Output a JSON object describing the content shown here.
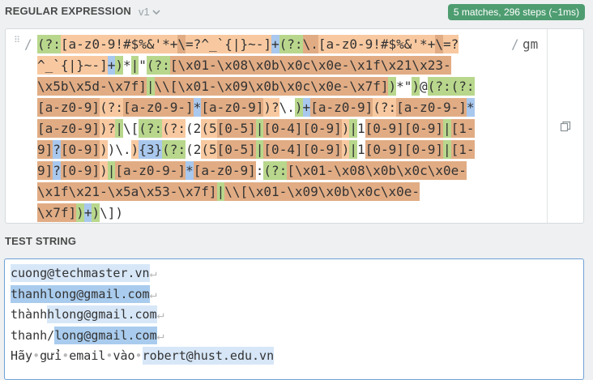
{
  "regex_section": {
    "title": "REGULAR EXPRESSION",
    "version": "v1",
    "match_info": "5 matches, 296 steps (~1ms)",
    "delimiter_open": "/",
    "delimiter_close": "/",
    "flags": "gm"
  },
  "regex_lines": [
    [
      [
        "(?:",
        "g"
      ],
      [
        "[a-z0-9!#$%&'*+",
        "o"
      ],
      [
        "\\",
        "d"
      ],
      [
        "=?^_`{|}~-]",
        "o"
      ],
      [
        "+",
        "b"
      ],
      [
        "(?:",
        "g"
      ],
      [
        "\\.",
        "d"
      ],
      [
        "[a-z0-9!#$%&'*+",
        "o"
      ],
      [
        "\\",
        "d"
      ],
      [
        "=?",
        "o"
      ]
    ],
    [
      [
        "^_`{|}~-]",
        "o"
      ],
      [
        "+",
        "b"
      ],
      [
        ")",
        "g"
      ],
      [
        "*",
        "n"
      ],
      [
        "|",
        "g"
      ],
      [
        "\"",
        "n"
      ],
      [
        "(?:",
        "g"
      ],
      [
        "[\\x01-\\x08\\x0b\\x0c\\x0e-\\x1f\\x21\\x23-",
        "d"
      ]
    ],
    [
      [
        "\\x5b\\x5d-\\x7f]",
        "d"
      ],
      [
        "|",
        "g"
      ],
      [
        "\\\\",
        "d"
      ],
      [
        "[\\x01-\\x09\\x0b\\x0c\\x0e-\\x7f]",
        "d"
      ],
      [
        ")",
        "g"
      ],
      [
        "*",
        "n"
      ],
      [
        "\"",
        "n"
      ],
      [
        ")",
        "g"
      ],
      [
        "@",
        "n"
      ],
      [
        "(?:",
        "g"
      ],
      [
        "(?:",
        "g"
      ]
    ],
    [
      [
        "[a-z0-9]",
        "d"
      ],
      [
        "(?:",
        "o"
      ],
      [
        "[a-z0-9-]",
        "d"
      ],
      [
        "*",
        "b"
      ],
      [
        "[a-z0-9]",
        "d"
      ],
      [
        ")?",
        "o"
      ],
      [
        "\\.",
        "n"
      ],
      [
        ")",
        "g"
      ],
      [
        "+",
        "b"
      ],
      [
        "[a-z0-9]",
        "d"
      ],
      [
        "(?:",
        "o"
      ],
      [
        "[a-z0-9-]",
        "d"
      ],
      [
        "*",
        "b"
      ]
    ],
    [
      [
        "[a-z0-9]",
        "d"
      ],
      [
        ")?",
        "o"
      ],
      [
        "|",
        "g"
      ],
      [
        "\\[",
        "n"
      ],
      [
        "(?:",
        "g"
      ],
      [
        "(?:",
        "o"
      ],
      [
        "(2",
        "n"
      ],
      [
        "(5",
        "o"
      ],
      [
        "[0-5]",
        "d"
      ],
      [
        "|",
        "g"
      ],
      [
        "[0-4]",
        "d"
      ],
      [
        "[0-9]",
        "d"
      ],
      [
        ")",
        "o"
      ],
      [
        "|",
        "g"
      ],
      [
        "1",
        "n"
      ],
      [
        "[0-9]",
        "d"
      ],
      [
        "[0-9]",
        "d"
      ],
      [
        "|",
        "g"
      ],
      [
        "[1-",
        "d"
      ]
    ],
    [
      [
        "9]",
        "d"
      ],
      [
        "?",
        "b"
      ],
      [
        "[0-9]",
        "d"
      ],
      [
        ")",
        "o"
      ],
      [
        ")",
        "n"
      ],
      [
        "\\.",
        "n"
      ],
      [
        ")",
        "o"
      ],
      [
        "{3}",
        "b"
      ],
      [
        "(?:",
        "g"
      ],
      [
        "(2",
        "n"
      ],
      [
        "(5",
        "o"
      ],
      [
        "[0-5]",
        "d"
      ],
      [
        "|",
        "g"
      ],
      [
        "[0-4]",
        "d"
      ],
      [
        "[0-9]",
        "d"
      ],
      [
        ")",
        "o"
      ],
      [
        "|",
        "g"
      ],
      [
        "1",
        "n"
      ],
      [
        "[0-9]",
        "d"
      ],
      [
        "[0-9]",
        "d"
      ],
      [
        "|",
        "g"
      ],
      [
        "[1-",
        "d"
      ]
    ],
    [
      [
        "9]",
        "d"
      ],
      [
        "?",
        "b"
      ],
      [
        "[0-9]",
        "d"
      ],
      [
        ")",
        "o"
      ],
      [
        "|",
        "g"
      ],
      [
        "[a-z0-9-]",
        "d"
      ],
      [
        "*",
        "b"
      ],
      [
        "[a-z0-9]",
        "d"
      ],
      [
        ":",
        "n"
      ],
      [
        "(?:",
        "g"
      ],
      [
        "[\\x01-\\x08\\x0b\\x0c\\x0e-",
        "d"
      ]
    ],
    [
      [
        "\\x1f\\x21-\\x5a\\x53-\\x7f]",
        "d"
      ],
      [
        "|",
        "g"
      ],
      [
        "\\\\",
        "d"
      ],
      [
        "[\\x01-\\x09\\x0b\\x0c\\x0e-",
        "d"
      ]
    ],
    [
      [
        "\\x7f]",
        "d"
      ],
      [
        ")",
        "g"
      ],
      [
        "+",
        "b"
      ],
      [
        ")",
        "g"
      ],
      [
        "\\]",
        "n"
      ],
      [
        ")",
        "n"
      ]
    ]
  ],
  "test_section": {
    "title": "TEST STRING"
  },
  "test_lines": [
    [
      [
        "cuong@techmaster.vn",
        "lt"
      ],
      [
        "↵",
        "ws"
      ]
    ],
    [
      [
        "thanhlong@gmail.com",
        "hl"
      ],
      [
        "↵",
        "ws"
      ]
    ],
    [
      [
        "thành",
        "n"
      ],
      [
        "hlong@gmail.com",
        "lt"
      ],
      [
        "↵",
        "ws"
      ]
    ],
    [
      [
        "thanh/",
        "n"
      ],
      [
        "long@gmail.com",
        "hl"
      ],
      [
        "↵",
        "ws"
      ]
    ],
    [
      [
        "Hãy",
        "n"
      ],
      [
        "•",
        "ws"
      ],
      [
        "gửi",
        "n"
      ],
      [
        "•",
        "ws"
      ],
      [
        "email",
        "n"
      ],
      [
        "•",
        "ws"
      ],
      [
        "vào",
        "n"
      ],
      [
        "•",
        "ws"
      ],
      [
        "robert@hust.edu.vn",
        "lt"
      ]
    ]
  ],
  "colors": {
    "badge": "#4e9d71",
    "orange": "#f8c9a0",
    "dark_orange": "#e1ac84",
    "green": "#b8d78c",
    "blue": "#a9c8ee",
    "match_dark": "#a9ccee",
    "match_light": "#d7e7f8"
  },
  "icons": [
    "chevron-down-icon",
    "drag-handle-icon",
    "copy-icon"
  ]
}
